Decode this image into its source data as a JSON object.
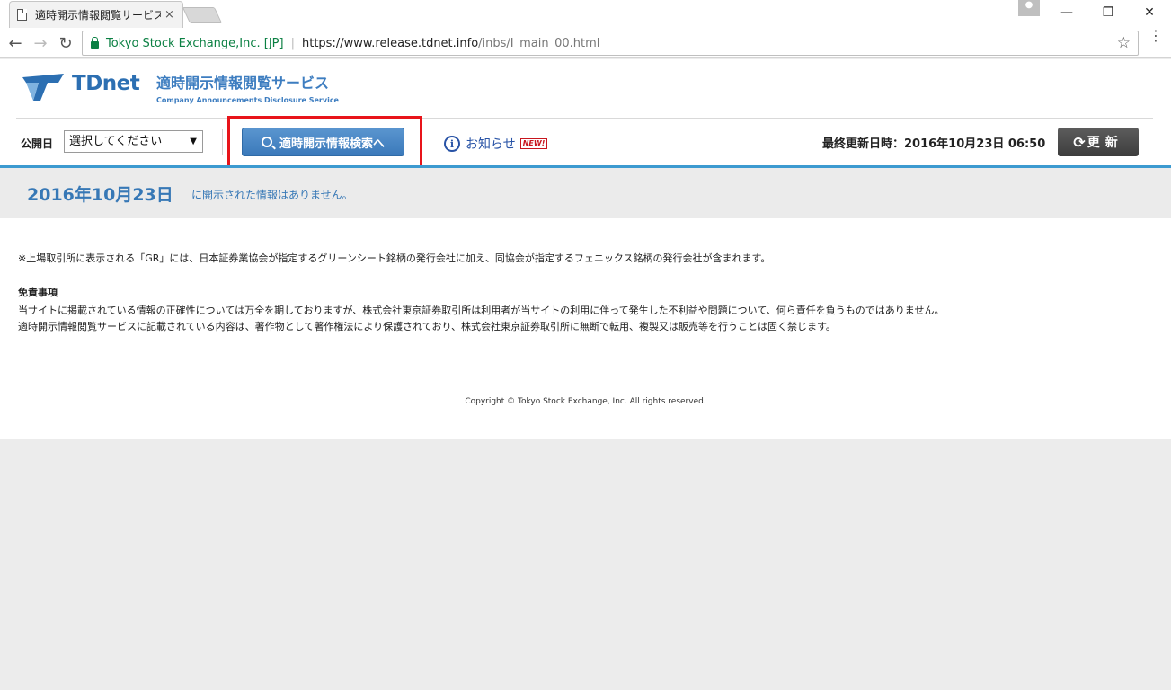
{
  "browser": {
    "tab_title": "適時開示情報閲覧サービス",
    "tab_close": "×",
    "secure_label": "Tokyo Stock Exchange,Inc. [JP]",
    "url_host": "https://www.release.tdnet.info",
    "url_path": "/inbs/I_main_00.html",
    "back": "←",
    "forward": "→",
    "reload": "↻",
    "star": "☆",
    "menu": "⋮",
    "minimize": "—",
    "restore": "❐",
    "close": "✕"
  },
  "header": {
    "logo_text": "TDnet",
    "service_title": "適時開示情報閲覧サービス",
    "service_subtitle": "Company Announcements Disclosure Service"
  },
  "controls": {
    "date_label": "公開日",
    "date_select_value": "選択してください",
    "date_select_arrow": "▼",
    "search_button": "適時開示情報検索へ",
    "notice_label": "お知らせ",
    "notice_icon": "i",
    "new_badge": "NEW!",
    "last_updated": "最終更新日時：2016年10月23日 06:50",
    "refresh_icon": "⟳",
    "refresh_label": "更新"
  },
  "date_band": {
    "date": "2016年10月23日",
    "message": "に開示された情報はありません。"
  },
  "body": {
    "note": "※上場取引所に表示される「GR」には、日本証券業協会が指定するグリーンシート銘柄の発行会社に加え、同協会が指定するフェニックス銘柄の発行会社が含まれます。",
    "disclaimer_title": "免責事項",
    "disclaimer_line1": "当サイトに掲載されている情報の正確性については万全を期しておりますが、株式会社東京証券取引所は利用者が当サイトの利用に伴って発生した不利益や問題について、何ら責任を負うものではありません。",
    "disclaimer_line2": "適時開示情報閲覧サービスに記載されている内容は、著作物として著作権法により保護されており、株式会社東京証券取引所に無断で転用、複製又は販売等を行うことは固く禁じます。"
  },
  "footer": {
    "copyright": "Copyright © Tokyo Stock Exchange, Inc. All rights reserved."
  },
  "colors": {
    "brand_blue": "#3778b6",
    "accent_rule": "#3c9ad0",
    "highlight": "#e8141a"
  }
}
